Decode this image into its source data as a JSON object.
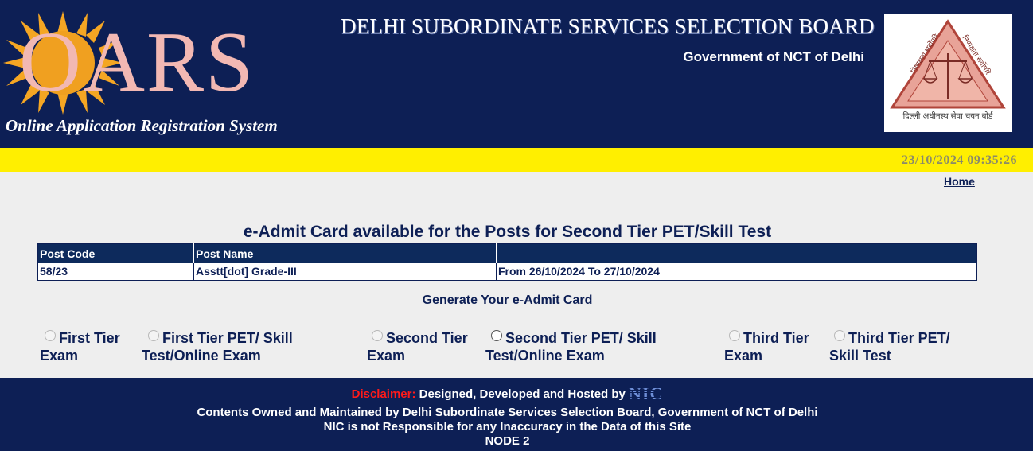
{
  "header": {
    "logo_text": "OARS",
    "tagline": "Online Application Registration System",
    "board_title": "DELHI SUBORDINATE SERVICES SELECTION BOARD",
    "government": "Government of NCT of Delhi",
    "emblem_text_left": "निष्पक्षता सर्वोपरि",
    "emblem_text_right": "निष्पक्षता सर्वोपरि",
    "emblem_text_bottom": "दिल्ली अधीनस्थ सेवा चयन बोर्ड"
  },
  "status_bar": {
    "datetime": "23/10/2024 09:35:26"
  },
  "nav": {
    "home": "Home"
  },
  "main": {
    "title": "e-Admit Card available for the Posts for Second Tier PET/Skill Test",
    "table": {
      "headers": [
        "Post Code",
        "Post Name",
        ""
      ],
      "rows": [
        [
          "58/23",
          "Asstt[dot] Grade-III",
          "From 26/10/2024 To 27/10/2024"
        ]
      ]
    },
    "generate_label": "Generate Your e-Admit Card",
    "exam_options": [
      {
        "line1": "First Tier",
        "line2": "Exam"
      },
      {
        "line1": "First Tier PET/ Skill",
        "line2": "Test/Online Exam"
      },
      {
        "line1": "Second Tier",
        "line2": "Exam"
      },
      {
        "line1": "Second Tier PET/ Skill",
        "line2": "Test/Online Exam"
      },
      {
        "line1": "Third Tier",
        "line2": "Exam"
      },
      {
        "line1": "Third Tier PET/",
        "line2": "Skill Test"
      }
    ]
  },
  "footer": {
    "disclaimer_label": "Disclaimer:",
    "hosted_by": "Designed, Developed and Hosted by",
    "nic_logo": "NIC",
    "line2": "Contents Owned and Maintained by Delhi Subordinate Services Selection Board, Government of NCT of Delhi",
    "line3": "NIC is not Responsible for any Inaccuracy in the Data of this Site",
    "node": "NODE 2"
  },
  "colors": {
    "navy": "#0d1f55",
    "yellow": "#ffef00",
    "logo_pink": "#f2b8b3",
    "sun_orange": "#f5a623",
    "disclaimer_red": "#ff1a1a"
  }
}
